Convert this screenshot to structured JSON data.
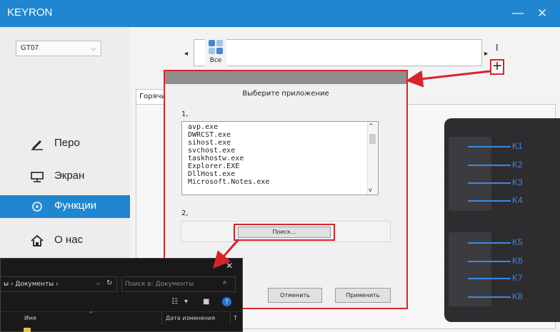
{
  "app": {
    "title": "KEYRON"
  },
  "window": {
    "minimize": "—",
    "close": "✕"
  },
  "sidebar": {
    "device": {
      "value": "GT07",
      "chevron": "⌵"
    },
    "items": [
      {
        "label": "Перо",
        "icon": "pen-icon"
      },
      {
        "label": "Экран",
        "icon": "monitor-icon"
      },
      {
        "label": "Функции",
        "icon": "settings-icon",
        "active": true
      },
      {
        "label": "О нас",
        "icon": "home-icon"
      }
    ]
  },
  "app_strip": {
    "selected_label": "Все",
    "left_arrow": "◂",
    "right_arrow": "▸",
    "bar": "I",
    "add": "+"
  },
  "tab": {
    "label": "Горячие"
  },
  "dialog": {
    "title": "Выберите приложение",
    "step1": "1,",
    "apps": [
      "avp.exe",
      "DWRCST.exe",
      "sihost.exe",
      "svchost.exe",
      "taskhostw.exe",
      "Explorer.EXE",
      "DllHost.exe",
      "Microsoft.Notes.exe"
    ],
    "step2": "2,",
    "search_button": "Поиск...",
    "cancel_button": "Отменить",
    "apply_button": "Применить",
    "scroll_up": "^",
    "scroll_down": "v"
  },
  "tablet_keys": [
    "K1",
    "K2",
    "K3",
    "K4",
    "K5",
    "K6",
    "K7",
    "K8"
  ],
  "explorer": {
    "close": "✕",
    "path": "ы › Документы ›",
    "path_chevron": "⌵",
    "refresh": "↻",
    "search_placeholder": "Поиск в: Документы",
    "search_icon": "⌕",
    "view_icon": "☷",
    "dropdown": "▾",
    "pane_icon": "■",
    "help": "?",
    "columns": [
      "Имя",
      "Дата изменения",
      "Т"
    ],
    "sort_indicator": "^"
  },
  "colors": {
    "accent": "#1f86cf",
    "highlight": "#d8232a",
    "key_label": "#3a8ae0"
  }
}
